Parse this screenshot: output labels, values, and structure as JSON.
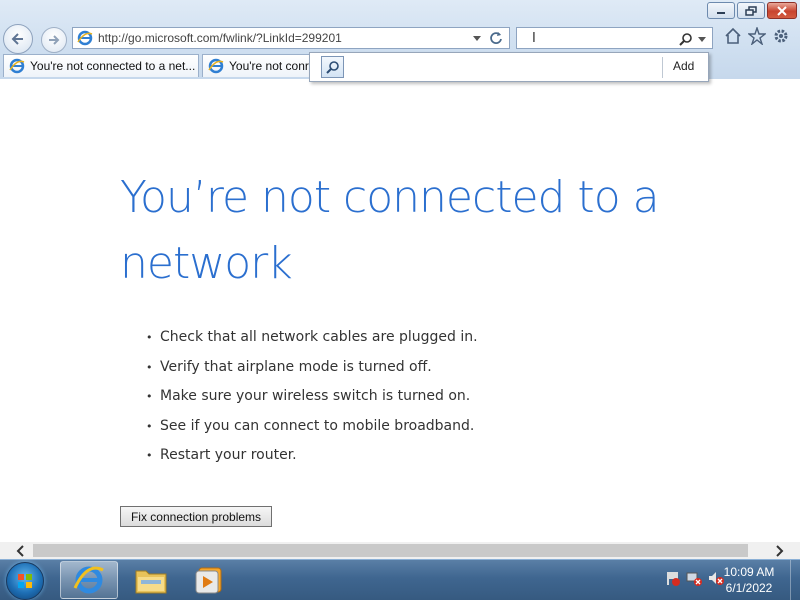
{
  "window": {
    "minimize_icon": "minimize-icon",
    "maximize_icon": "restore-icon",
    "close_icon": "close-icon"
  },
  "navigation": {
    "back_icon": "back-arrow-icon",
    "forward_icon": "forward-arrow-icon"
  },
  "address_bar": {
    "url": "http://go.microsoft.com/fwlink/?LinkId=299201"
  },
  "search": {
    "value": ""
  },
  "search_dropdown": {
    "add_label": "Add"
  },
  "tabs": [
    {
      "label": "You're not connected to a net..."
    },
    {
      "label": "You're not conr"
    }
  ],
  "page": {
    "heading": "You’re not connected to a network",
    "tips": [
      "Check that all network cables are plugged in.",
      "Verify that airplane mode is turned off.",
      "Make sure your wireless switch is turned on.",
      "See if you can connect to mobile broadband.",
      "Restart your router."
    ],
    "fix_button": "Fix connection problems"
  },
  "taskbar": {
    "items": [
      "internet-explorer",
      "windows-explorer",
      "media-player"
    ],
    "clock_time": "10:09 AM",
    "clock_date": "6/1/2022"
  },
  "colors": {
    "heading": "#2b6fcf",
    "taskbar": "#3f6690",
    "chrome": "#cfdff0"
  }
}
